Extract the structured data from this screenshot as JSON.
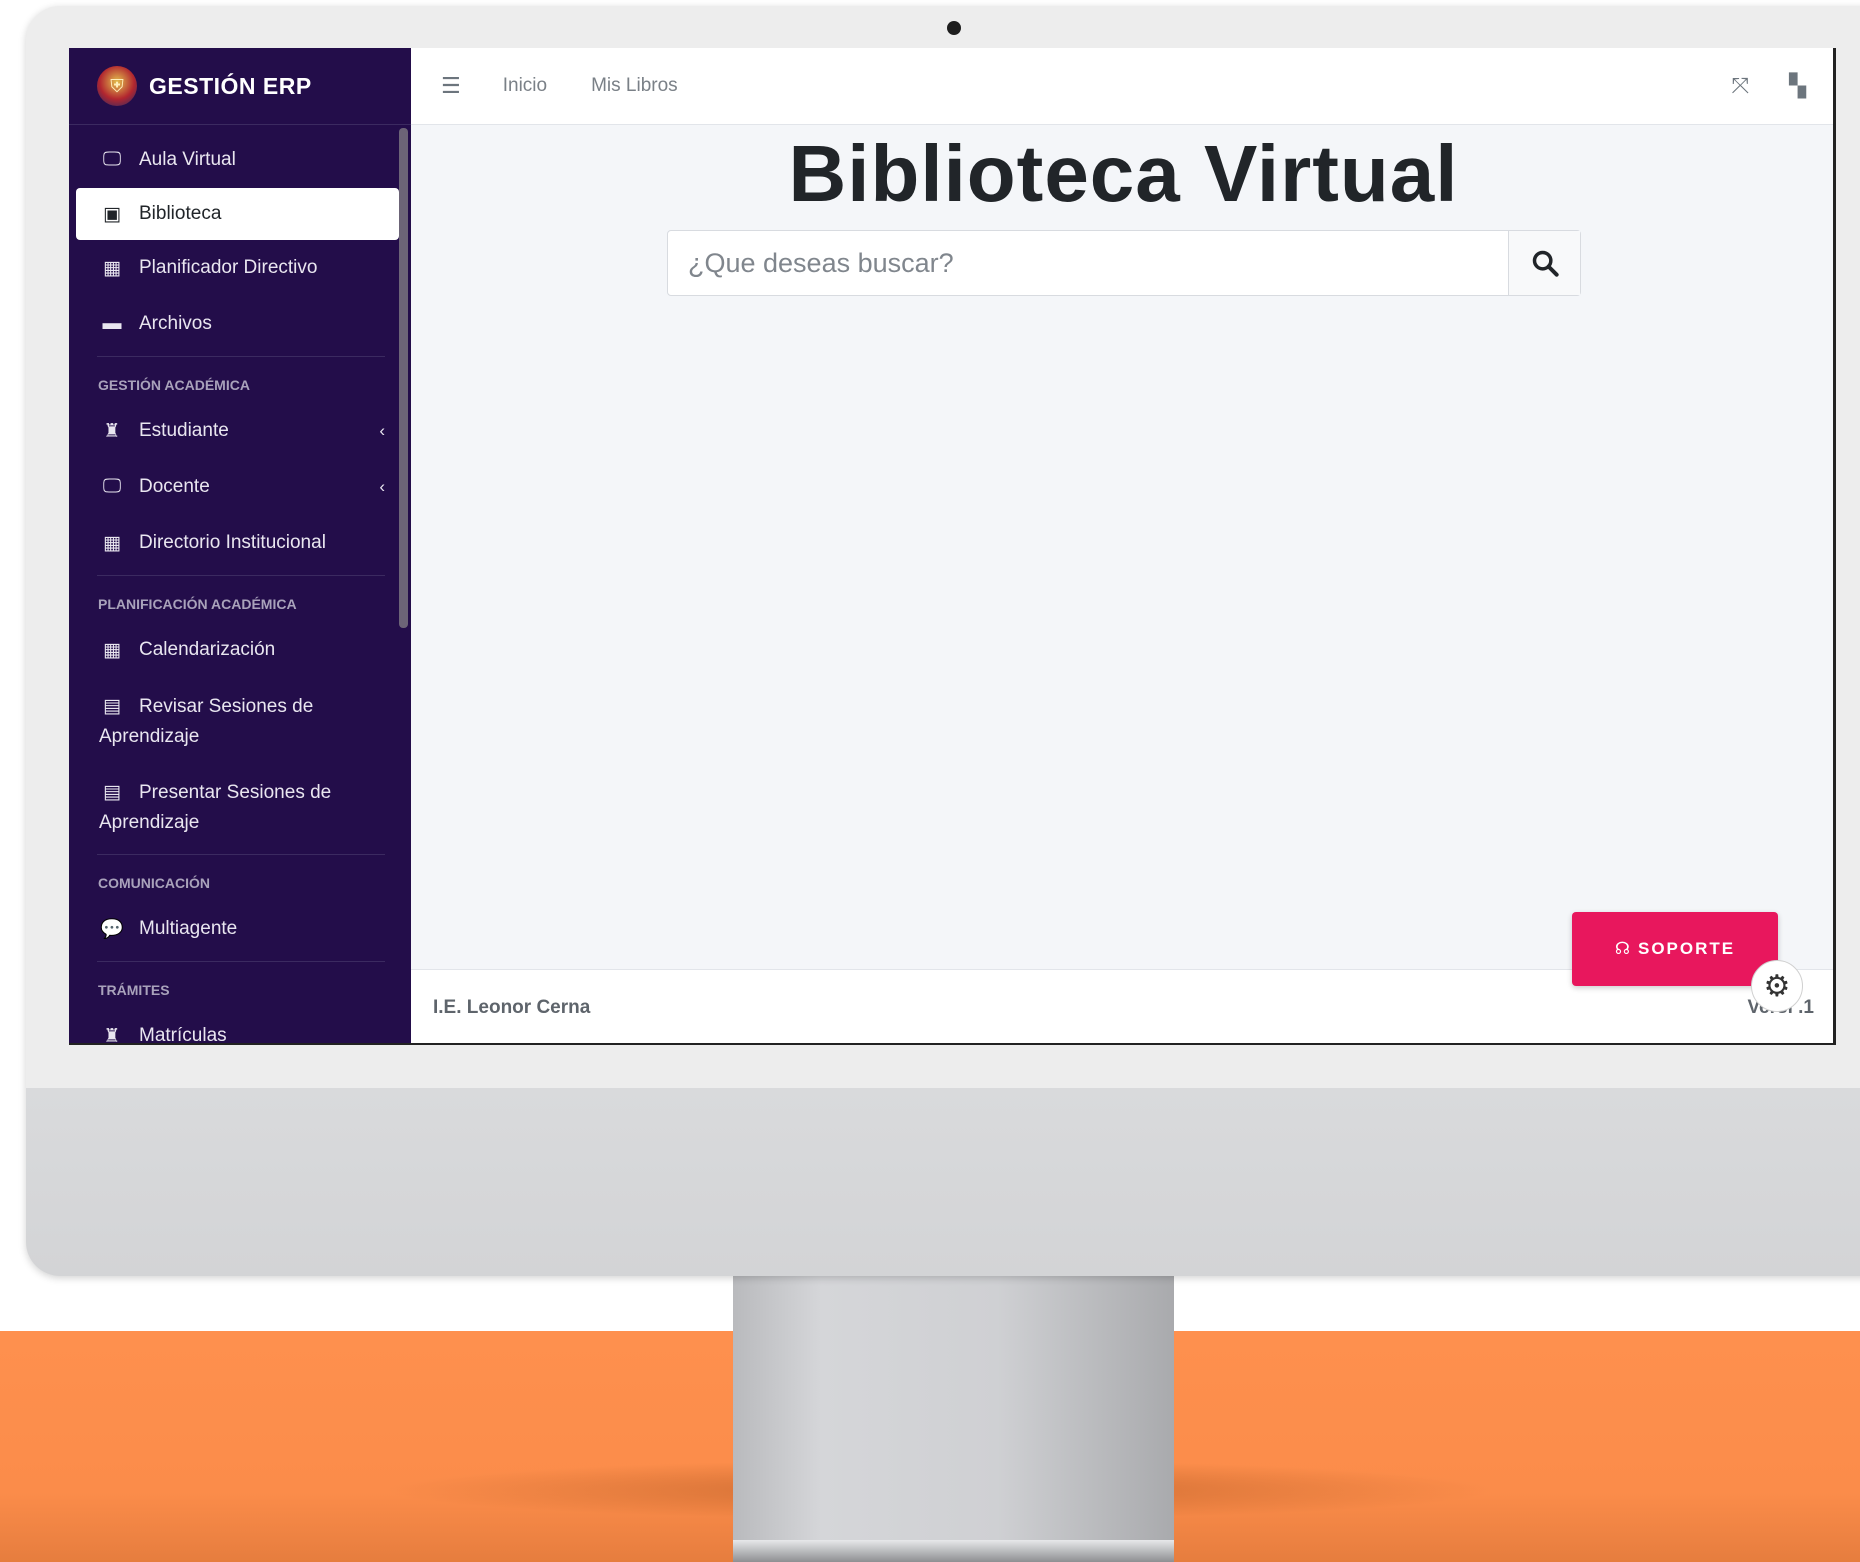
{
  "brand": {
    "title": "GESTIÓN ERP",
    "logo_icon": "shield-crest-icon"
  },
  "sidebar": {
    "items_top": [
      {
        "label": "Aula Virtual",
        "icon": "chalkboard-teacher-icon"
      },
      {
        "label": "Biblioteca",
        "icon": "book-icon",
        "active": true
      },
      {
        "label": "Planificador Directivo",
        "icon": "calendar-icon"
      },
      {
        "label": "Archivos",
        "icon": "hdd-icon"
      }
    ],
    "section_academica": "GESTIÓN ACADÉMICA",
    "items_academica": [
      {
        "label": "Estudiante",
        "icon": "user-graduate-icon",
        "chevron": "‹"
      },
      {
        "label": "Docente",
        "icon": "chalkboard-teacher-icon",
        "chevron": "‹"
      },
      {
        "label": "Directorio Institucional",
        "icon": "calendar-icon"
      }
    ],
    "section_planificacion": "PLANIFICACIÓN ACADÉMICA",
    "items_planificacion": [
      {
        "label": "Calendarización",
        "icon": "calendar-icon"
      },
      {
        "label": "Revisar Sesiones de Aprendizaje",
        "icon": "file-icon"
      },
      {
        "label": "Presentar Sesiones de Aprendizaje",
        "icon": "file-icon"
      }
    ],
    "section_comunicacion": "COMUNICACIÓN",
    "items_comunicacion": [
      {
        "label": "Multiagente",
        "icon": "comments-icon"
      }
    ],
    "section_tramites": "TRÁMITES",
    "items_tramites": [
      {
        "label": "Matrículas",
        "icon": "user-graduate-icon"
      }
    ]
  },
  "topbar": {
    "menu_icon": "hamburger-icon",
    "links": [
      "Inicio",
      "Mis Libros"
    ],
    "fullscreen_icon": "expand-icon",
    "apps_icon": "grid-icon"
  },
  "main": {
    "title": "Biblioteca Virtual",
    "search_placeholder": "¿Que deseas buscar?",
    "search_icon": "search-icon"
  },
  "footer": {
    "org": "I.E. Leonor Cerna",
    "version": "Versi   .1"
  },
  "support": {
    "label": "SOPORTE",
    "icon": "headset-icon"
  },
  "chatbot": {
    "icon": "openai-logo-icon"
  },
  "colors": {
    "sidebar": "#230d4a",
    "accent": "#e8175d",
    "floor": "#fe904e"
  }
}
